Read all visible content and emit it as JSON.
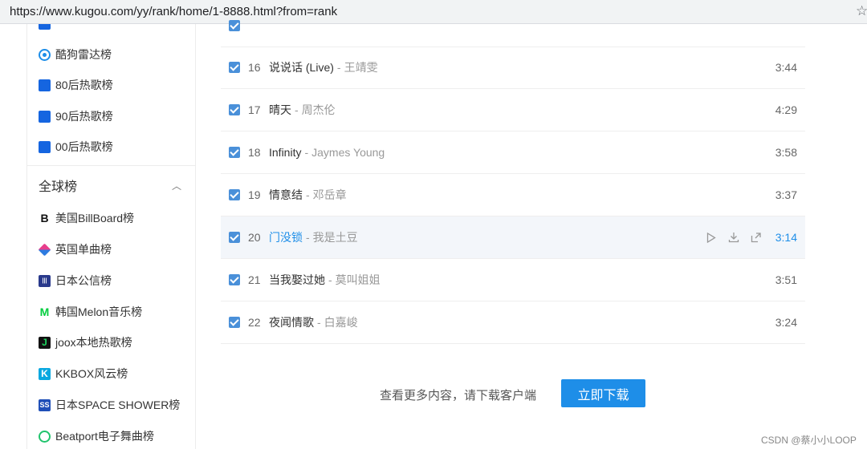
{
  "browser": {
    "url": "https://www.kugou.com/yy/rank/home/1-8888.html?from=rank"
  },
  "sidebar": {
    "items_top": [
      {
        "label": "酷狗雷达榜",
        "icon": "radar-icon",
        "color": "#1e8ee8"
      },
      {
        "label": "80后热歌榜",
        "icon": "blue-square-icon",
        "color": "#1565e0"
      },
      {
        "label": "90后热歌榜",
        "icon": "blue-square-icon",
        "color": "#1565e0"
      },
      {
        "label": "00后热歌榜",
        "icon": "blue-square-icon",
        "color": "#1565e0"
      }
    ],
    "section_title": "全球榜",
    "items_global": [
      {
        "label": "美国BillBoard榜",
        "icon": "billboard-logo-icon"
      },
      {
        "label": "英国单曲榜",
        "icon": "uk-chart-logo-icon"
      },
      {
        "label": "日本公信榜",
        "icon": "oricon-logo-icon"
      },
      {
        "label": "韩国Melon音乐榜",
        "icon": "melon-logo-icon"
      },
      {
        "label": "joox本地热歌榜",
        "icon": "joox-logo-icon"
      },
      {
        "label": "KKBOX风云榜",
        "icon": "kkbox-logo-icon"
      },
      {
        "label": "日本SPACE SHOWER榜",
        "icon": "space-shower-logo-icon"
      },
      {
        "label": "Beatport电子舞曲榜",
        "icon": "beatport-logo-icon"
      }
    ]
  },
  "songs": [
    {
      "num": "16",
      "title": "说说话 (Live)",
      "artist": "王靖雯",
      "duration": "3:44"
    },
    {
      "num": "17",
      "title": "晴天",
      "artist": "周杰伦",
      "duration": "4:29"
    },
    {
      "num": "18",
      "title": "Infinity",
      "artist": "Jaymes Young",
      "duration": "3:58"
    },
    {
      "num": "19",
      "title": "情意结",
      "artist": "邓岳章",
      "duration": "3:37"
    },
    {
      "num": "20",
      "title": "门没锁",
      "artist": "我是土豆",
      "duration": "3:14"
    },
    {
      "num": "21",
      "title": "当我娶过她",
      "artist": "莫叫姐姐",
      "duration": "3:51"
    },
    {
      "num": "22",
      "title": "夜闻情歌",
      "artist": "白嘉峻",
      "duration": "3:24"
    }
  ],
  "separator": "-",
  "footer": {
    "more_text": "查看更多内容，请下载客户端",
    "download_label": "立即下载"
  },
  "watermark": "CSDN @蔡小小LOOP",
  "colors": {
    "accent": "#1e8ee8"
  }
}
